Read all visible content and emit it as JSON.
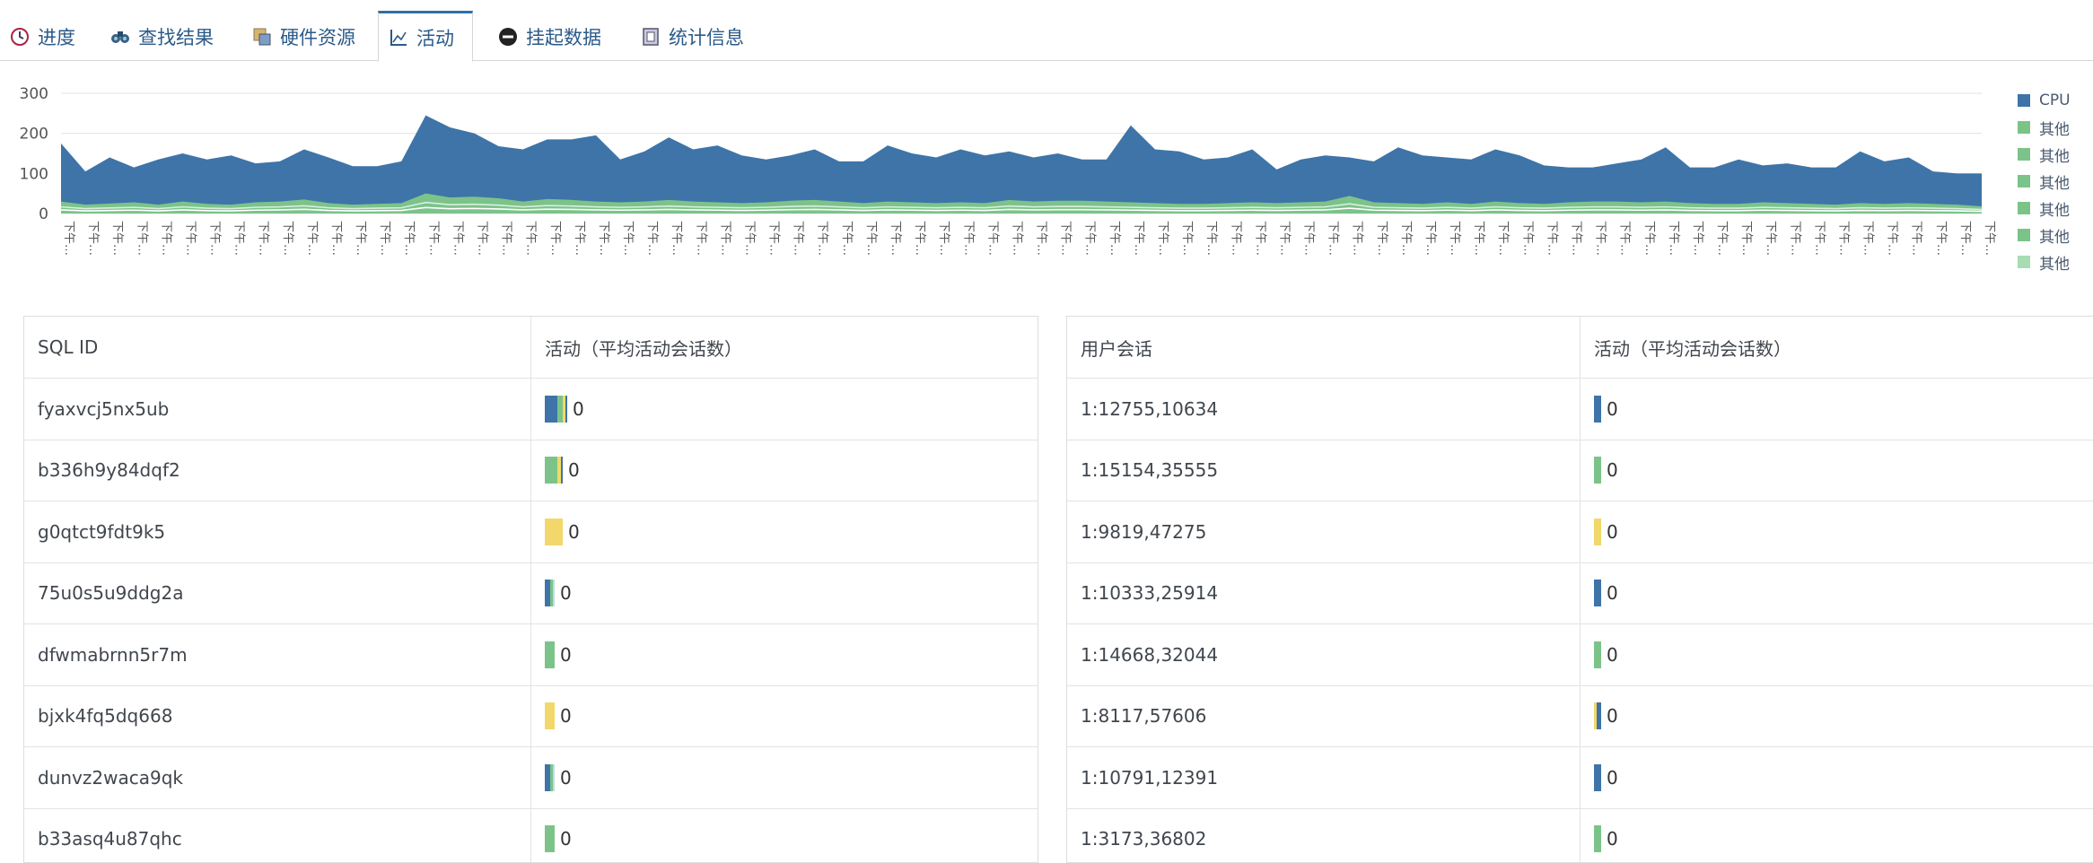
{
  "tabs": [
    {
      "label": "进度",
      "icon": "clock-icon"
    },
    {
      "label": "查找结果",
      "icon": "binoculars-icon"
    },
    {
      "label": "硬件资源",
      "icon": "hardware-icon"
    },
    {
      "label": "活动",
      "icon": "chart-axes-icon",
      "active": true
    },
    {
      "label": "挂起数据",
      "icon": "minus-circle-icon"
    },
    {
      "label": "统计信息",
      "icon": "stats-icon"
    }
  ],
  "colors": {
    "cpu": "#3e74a8",
    "other": "#7cc38a",
    "yellow": "#f2d86a",
    "tab_active_border": "#2f6fa8"
  },
  "chart_data": {
    "type": "area",
    "ylim": [
      0,
      300
    ],
    "yticks": [
      0,
      100,
      200,
      300
    ],
    "x_tick_label": "下午…",
    "x_tick_count": 80,
    "legend": [
      "CPU",
      "其他",
      "其他",
      "其他",
      "其他",
      "其他",
      "其他"
    ],
    "legend_position": "right",
    "series": [
      {
        "name": "CPU",
        "values": [
          175,
          105,
          140,
          115,
          135,
          150,
          135,
          145,
          125,
          130,
          160,
          140,
          118,
          118,
          130,
          245,
          215,
          200,
          168,
          160,
          185,
          185,
          195,
          135,
          155,
          190,
          160,
          170,
          145,
          135,
          145,
          160,
          130,
          130,
          170,
          150,
          140,
          160,
          145,
          155,
          140,
          150,
          135,
          135,
          220,
          160,
          155,
          135,
          140,
          160,
          110,
          135,
          145,
          140,
          130,
          165,
          145,
          140,
          135,
          160,
          145,
          120,
          115,
          115,
          125,
          135,
          165,
          115,
          115,
          135,
          120,
          125,
          115,
          115,
          155,
          130,
          140,
          105,
          100,
          100
        ]
      },
      {
        "name": "其他",
        "values": [
          30,
          22,
          25,
          28,
          22,
          30,
          24,
          22,
          28,
          30,
          35,
          26,
          22,
          24,
          26,
          50,
          40,
          42,
          38,
          30,
          36,
          34,
          30,
          28,
          30,
          34,
          30,
          28,
          26,
          28,
          32,
          34,
          30,
          26,
          30,
          28,
          26,
          28,
          26,
          34,
          30,
          32,
          32,
          30,
          28,
          26,
          24,
          24,
          26,
          28,
          26,
          28,
          30,
          44,
          28,
          26,
          24,
          28,
          24,
          30,
          26,
          24,
          28,
          30,
          30,
          28,
          30,
          26,
          24,
          24,
          28,
          26,
          24,
          22,
          26,
          24,
          26,
          24,
          22,
          18
        ]
      }
    ]
  },
  "left_table": {
    "headers": [
      "SQL ID",
      "活动（平均活动会话数）"
    ],
    "rows": [
      {
        "id": "fyaxvcj5nx5ub",
        "value": "0",
        "bars": [
          [
            "#3e74a8",
            14
          ],
          [
            "#7cc38a",
            6
          ],
          [
            "#f2d86a",
            3
          ],
          [
            "#3e74a8",
            2
          ]
        ]
      },
      {
        "id": "b336h9y84dqf2",
        "value": "0",
        "bars": [
          [
            "#7cc38a",
            14
          ],
          [
            "#f2d86a",
            4
          ],
          [
            "#3e74a8",
            2
          ]
        ]
      },
      {
        "id": "g0qtct9fdt9k5",
        "value": "0",
        "bars": [
          [
            "#f2d86a",
            20
          ]
        ]
      },
      {
        "id": "75u0s5u9ddg2a",
        "value": "0",
        "bars": [
          [
            "#3e74a8",
            6
          ],
          [
            "#7cc38a",
            3
          ],
          [
            "#c5d7e8",
            2
          ]
        ]
      },
      {
        "id": "dfwmabrnn5r7m",
        "value": "0",
        "bars": [
          [
            "#7cc38a",
            11
          ]
        ]
      },
      {
        "id": "bjxk4fq5dq668",
        "value": "0",
        "bars": [
          [
            "#f2d86a",
            11
          ]
        ]
      },
      {
        "id": "dunvz2waca9qk",
        "value": "0",
        "bars": [
          [
            "#3e74a8",
            6
          ],
          [
            "#7cc38a",
            3
          ],
          [
            "#c5d7e8",
            2
          ]
        ]
      },
      {
        "id": "b33asq4u87qhc",
        "value": "0",
        "bars": [
          [
            "#7cc38a",
            11
          ]
        ]
      }
    ]
  },
  "right_table": {
    "headers": [
      "用户会话",
      "活动（平均活动会话数）"
    ],
    "rows": [
      {
        "id": "1:12755,10634",
        "value": "0",
        "bars": [
          [
            "#3e74a8",
            8
          ]
        ]
      },
      {
        "id": "1:15154,35555",
        "value": "0",
        "bars": [
          [
            "#7cc38a",
            8
          ]
        ]
      },
      {
        "id": "1:9819,47275",
        "value": "0",
        "bars": [
          [
            "#f2d86a",
            8
          ]
        ]
      },
      {
        "id": "1:10333,25914",
        "value": "0",
        "bars": [
          [
            "#3e74a8",
            8
          ]
        ]
      },
      {
        "id": "1:14668,32044",
        "value": "0",
        "bars": [
          [
            "#7cc38a",
            8
          ]
        ]
      },
      {
        "id": "1:8117,57606",
        "value": "0",
        "bars": [
          [
            "#f2d86a",
            3
          ],
          [
            "#3e74a8",
            5
          ]
        ]
      },
      {
        "id": "1:10791,12391",
        "value": "0",
        "bars": [
          [
            "#3e74a8",
            8
          ]
        ]
      },
      {
        "id": "1:3173,36802",
        "value": "0",
        "bars": [
          [
            "#7cc38a",
            8
          ]
        ]
      }
    ]
  }
}
